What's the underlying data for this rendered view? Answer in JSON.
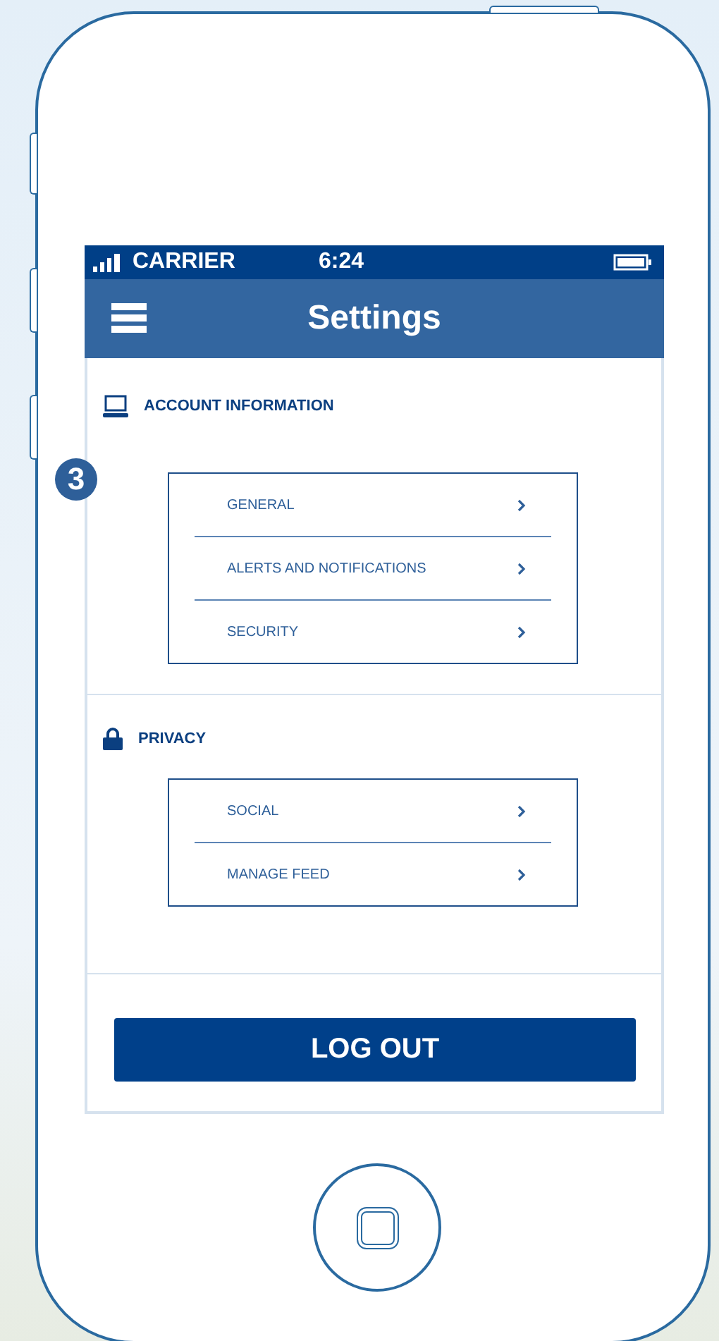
{
  "status_bar": {
    "carrier": "CARRIER",
    "time": "6:24"
  },
  "nav_bar": {
    "title": "Settings"
  },
  "callout": "3",
  "sections": [
    {
      "title": "ACCOUNT INFORMATION",
      "kind": "laptop",
      "items": [
        {
          "label": "GENERAL"
        },
        {
          "label": "ALERTS AND NOTIFICATIONS"
        },
        {
          "label": "SECURITY"
        }
      ]
    },
    {
      "title": "PRIVACY",
      "kind": "lock",
      "items": [
        {
          "label": "SOCIAL"
        },
        {
          "label": "MANAGE FEED"
        }
      ]
    }
  ],
  "logout_button": "LOG OUT"
}
